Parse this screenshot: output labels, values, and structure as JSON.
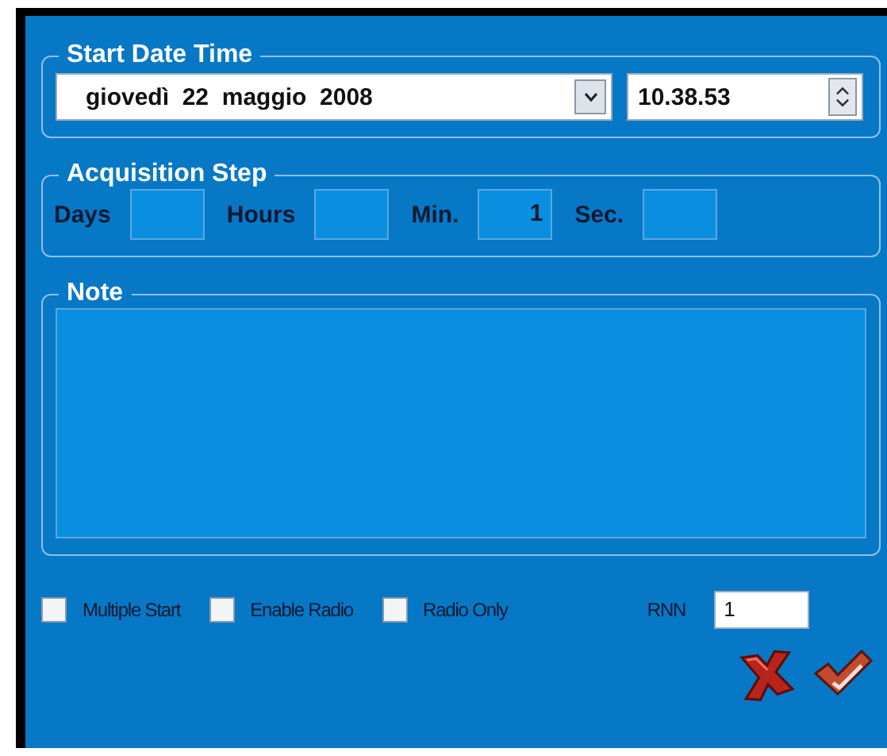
{
  "start_date_time": {
    "title": "Start Date Time",
    "date": "giovedì  22  maggio  2008",
    "time": "10.38.53"
  },
  "acquisition_step": {
    "title": "Acquisition Step",
    "fields": [
      {
        "label": "Days"
      },
      {
        "label": "Hours"
      },
      {
        "label": "Min.",
        "value": "1"
      },
      {
        "label": "Sec."
      }
    ]
  },
  "note": {
    "title": "Note"
  },
  "options": [
    {
      "label": "Multiple Start",
      "checked": false
    },
    {
      "label": "Enable Radio",
      "checked": false
    },
    {
      "label": "Radio Only",
      "checked": false
    }
  ],
  "rnn": {
    "label": "RNN",
    "value": "1"
  },
  "buttons": [
    {
      "kind": "cancel"
    },
    {
      "kind": "confirm"
    }
  ]
}
